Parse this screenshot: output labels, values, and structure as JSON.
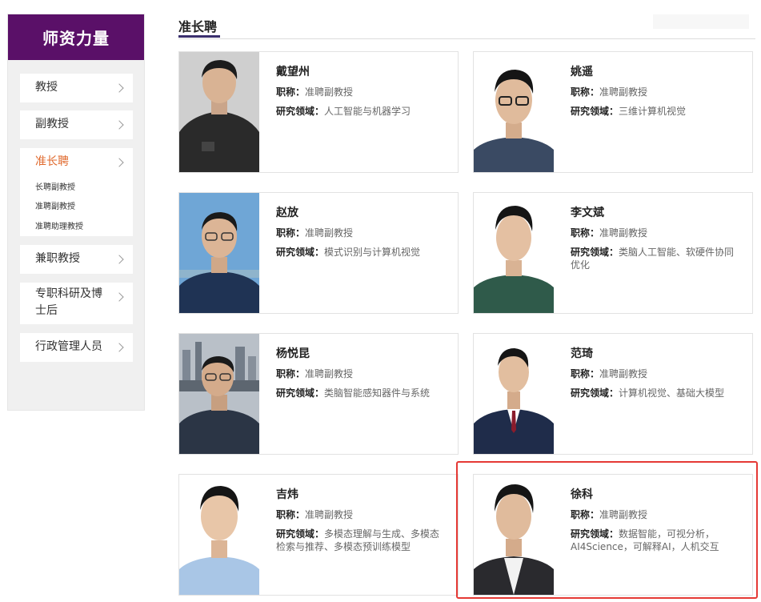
{
  "sidebar": {
    "title": "师资力量",
    "items": [
      {
        "label": "教授"
      },
      {
        "label": "副教授"
      },
      {
        "label": "准长聘"
      },
      {
        "label": "兼职教授"
      },
      {
        "label": "专职科研及博士后"
      },
      {
        "label": "行政管理人员"
      }
    ],
    "sub_items": [
      {
        "label": "长聘副教授"
      },
      {
        "label": "准聘副教授"
      },
      {
        "label": "准聘助理教授"
      }
    ]
  },
  "main": {
    "section_title": "准长聘",
    "title_key": "职称：",
    "field_key": "研究领域：",
    "cards": [
      {
        "name": "戴望州",
        "title": "准聘副教授",
        "field": "人工智能与机器学习"
      },
      {
        "name": "姚遥",
        "title": "准聘副教授",
        "field": "三维计算机视觉"
      },
      {
        "name": "赵放",
        "title": "准聘副教授",
        "field": "模式识别与计算机视觉"
      },
      {
        "name": "李文斌",
        "title": "准聘副教授",
        "field": "类脑人工智能、软硬件协同优化"
      },
      {
        "name": "杨悦昆",
        "title": "准聘副教授",
        "field": "类脑智能感知器件与系统"
      },
      {
        "name": "范琦",
        "title": "准聘副教授",
        "field": "计算机视觉、基础大模型"
      },
      {
        "name": "吉炜",
        "title": "准聘副教授",
        "field": "多模态理解与生成、多模态检索与推荐、多模态预训练模型"
      },
      {
        "name": "徐科",
        "title": "准聘副教授",
        "field": "数据智能，可视分析，AI4Science，可解释AI，人机交互"
      }
    ]
  },
  "colors": {
    "sidebar_header": "#5a1068",
    "active_menu": "#e06a2e",
    "tab_underline": "#3a2f6d",
    "highlight": "#e53935"
  }
}
